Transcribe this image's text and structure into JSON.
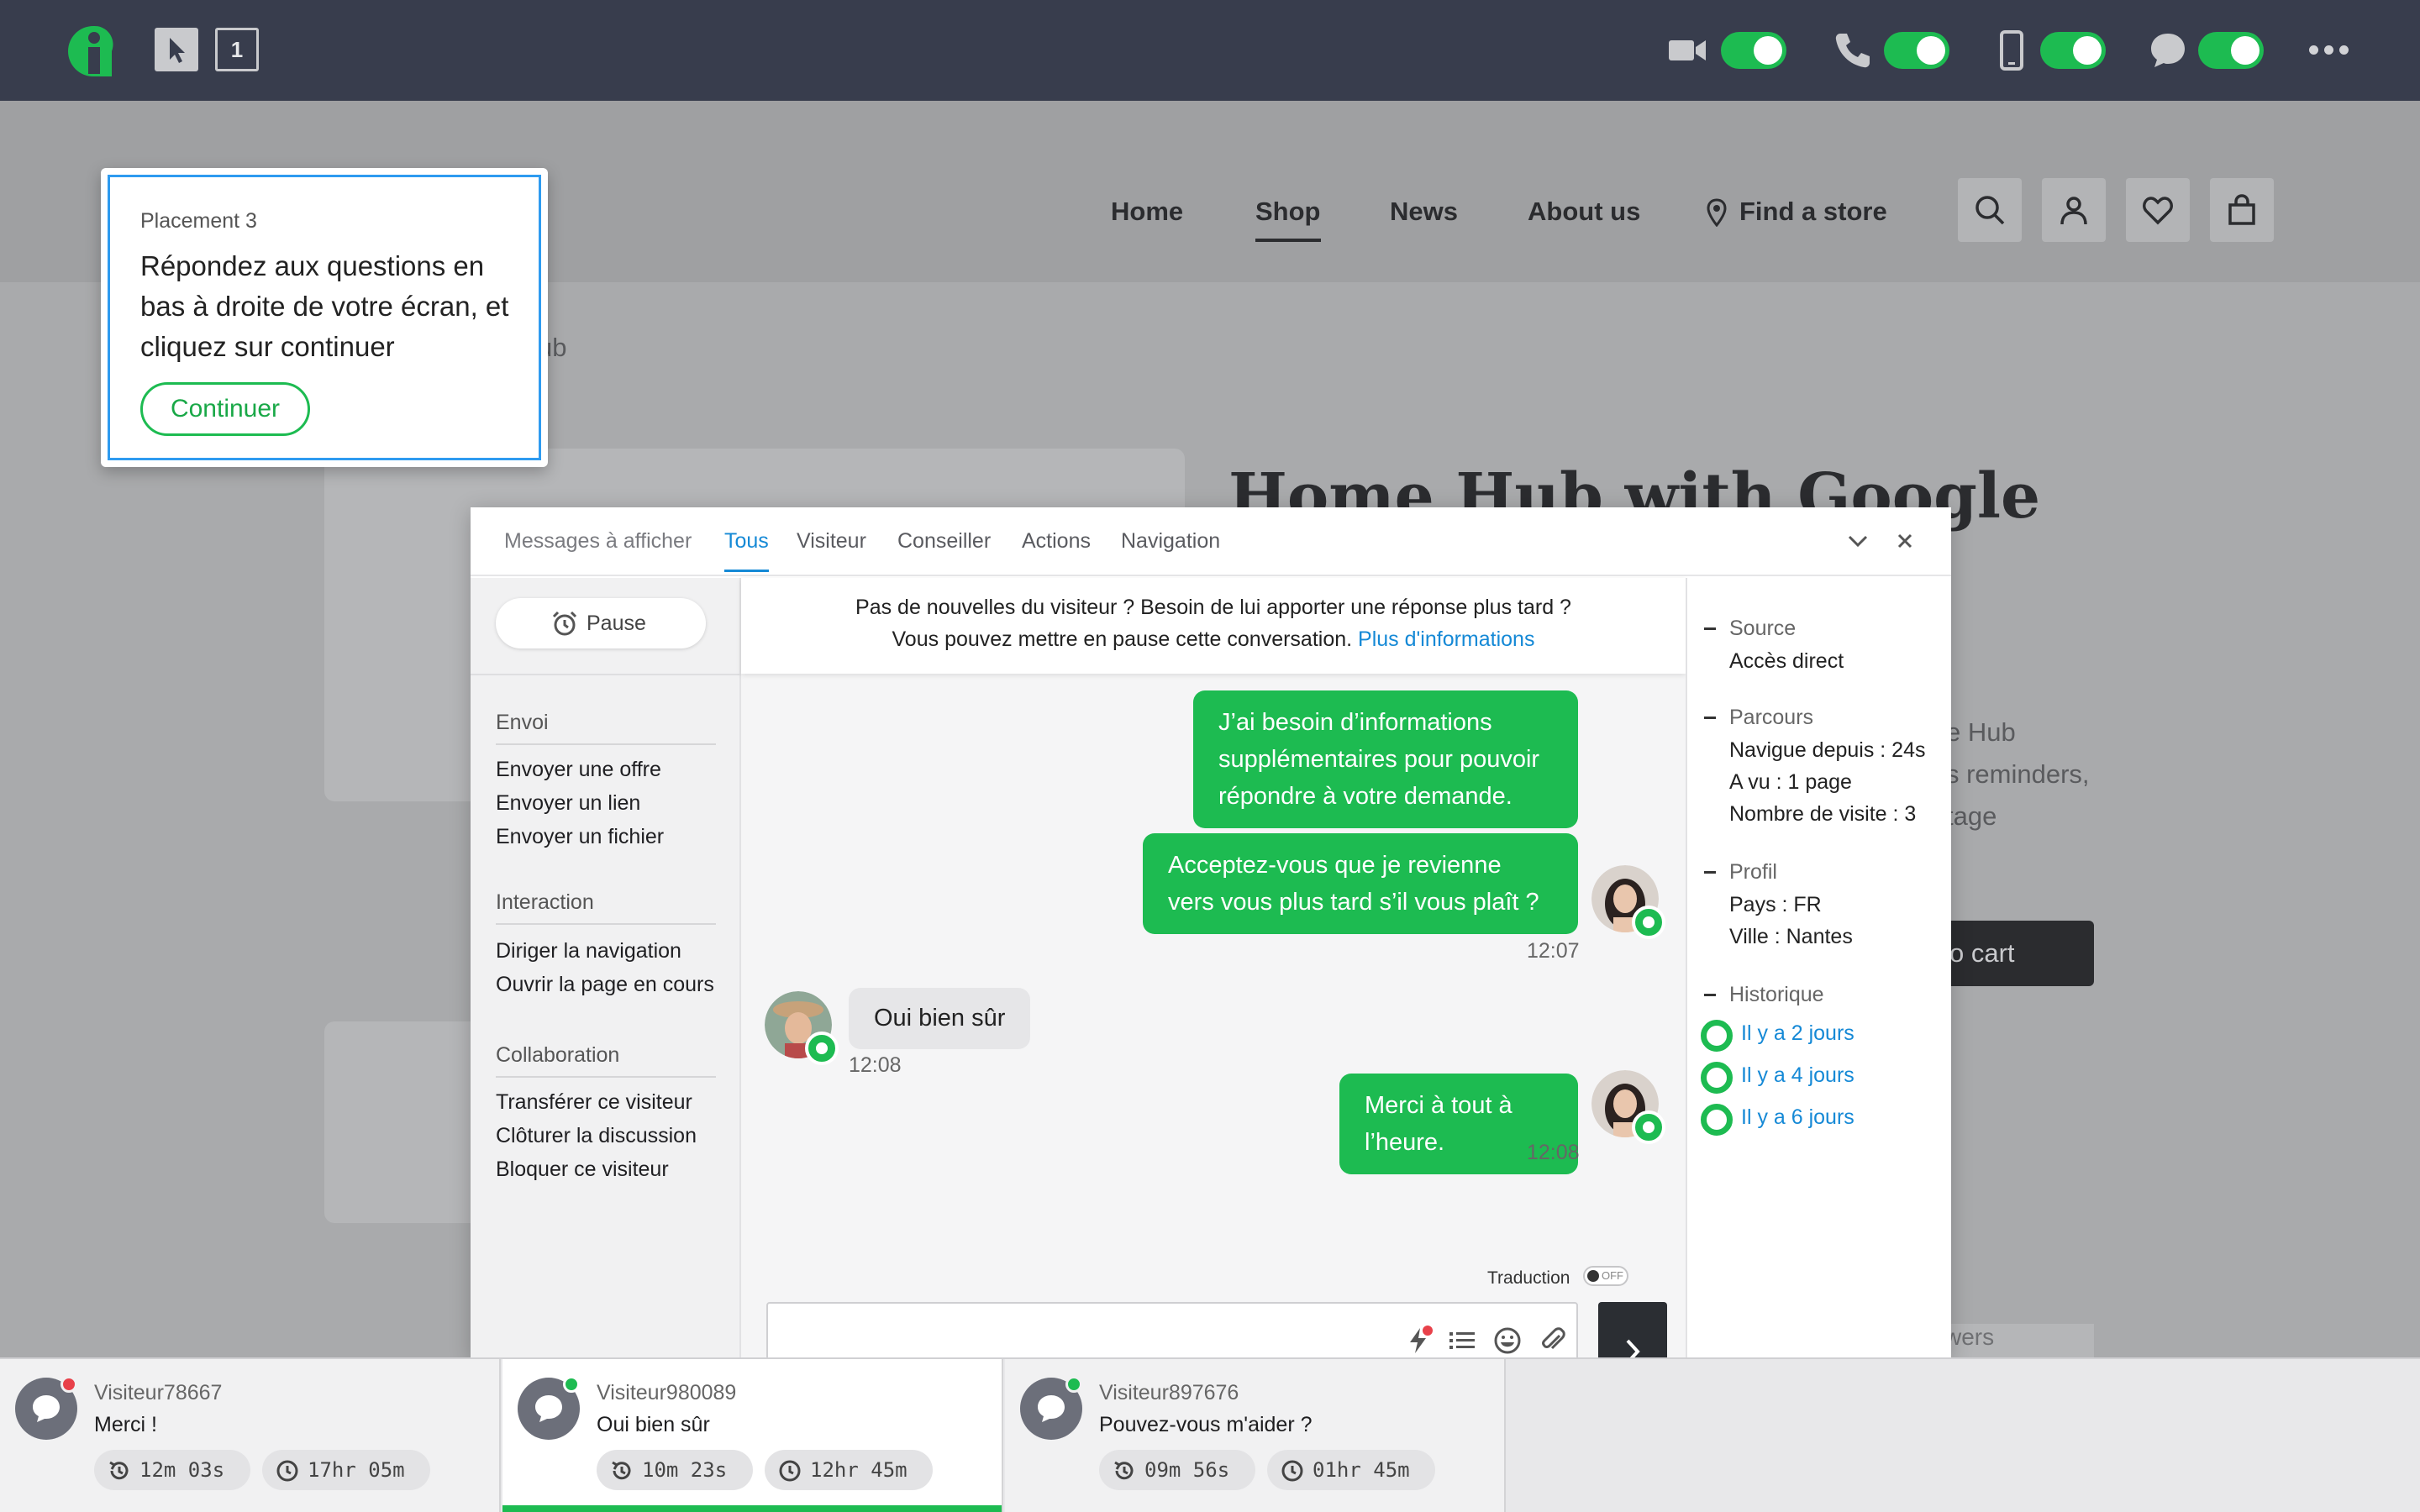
{
  "topbar": {
    "cursor_label": "1",
    "icons": [
      "logo-icon",
      "cursor-icon",
      "video-icon",
      "phone-icon",
      "mobile-icon",
      "chat-bubble-icon",
      "more-icon"
    ],
    "toggles": {
      "video": true,
      "phone": true,
      "mobile": true,
      "chat": true
    },
    "accent_color": "#1dbb51",
    "bar_color": "#383d4d"
  },
  "site": {
    "nav": [
      "Home",
      "Shop",
      "News",
      "About us",
      "Find a store"
    ],
    "active_nav": "Shop",
    "breadcrumb_tail": "ub",
    "product_title": "Home Hub with Google",
    "desc_lines": [
      "e Hub",
      "s reminders,",
      "tage"
    ],
    "cart_label": "o cart",
    "answers_label": "swers"
  },
  "tooltip": {
    "eyebrow": "Placement 3",
    "body": "Répondez aux questions en bas à droite de votre écran, et cliquez sur continuer",
    "button": "Continuer"
  },
  "panel": {
    "filter_label": "Messages à afficher",
    "tabs": [
      "Tous",
      "Visiteur",
      "Conseiller",
      "Actions",
      "Navigation"
    ],
    "active_tab": "Tous",
    "pause_label": "Pause",
    "sections": [
      {
        "title": "Envoi",
        "actions": [
          "Envoyer une offre",
          "Envoyer un lien",
          "Envoyer un fichier"
        ]
      },
      {
        "title": "Interaction",
        "actions": [
          "Diriger la navigation",
          "Ouvrir la page en cours"
        ]
      },
      {
        "title": "Collaboration",
        "actions": [
          "Transférer ce visiteur",
          "Clôturer la discussion",
          "Bloquer ce visiteur"
        ]
      }
    ],
    "notice": {
      "line1": "Pas de nouvelles du visiteur ? Besoin de lui apporter une réponse plus tard ?",
      "line2": "Vous pouvez mettre en pause cette conversation.",
      "link": "Plus d'informations"
    },
    "messages": [
      {
        "from": "agent",
        "text": "J’ai besoin d’informations supplémentaires pour pouvoir répondre à votre demande."
      },
      {
        "from": "agent",
        "text": "Acceptez-vous que je revienne vers vous plus tard s’il vous plaît ?",
        "time": "12:07"
      },
      {
        "from": "visitor",
        "text": "Oui bien sûr",
        "time": "12:08"
      },
      {
        "from": "agent",
        "text": "Merci à tout à l’heure.",
        "time": "12:08"
      }
    ],
    "translation_label": "Traduction",
    "translation_state": "OFF",
    "info": {
      "source_label": "Source",
      "source_value": "Accès direct",
      "parcours_label": "Parcours",
      "parcours_values": [
        "Navigue depuis : 24s",
        "A vu : 1 page",
        "Nombre de visite : 3"
      ],
      "profil_label": "Profil",
      "profil_values": [
        "Pays : FR",
        "Ville : Nantes"
      ],
      "historique_label": "Historique",
      "historique_items": [
        "Il y a 2 jours",
        "Il y a 4 jours",
        "Il y a 6 jours"
      ]
    }
  },
  "visitors": [
    {
      "name": "Visiteur78667",
      "message": "Merci !",
      "elapsed": "12m 03s",
      "duration": "17hr 05m",
      "status_color": "#e8414a",
      "active": false
    },
    {
      "name": "Visiteur980089",
      "message": "Oui bien sûr",
      "elapsed": "10m 23s",
      "duration": "12hr 45m",
      "status_color": "#1dbb51",
      "active": true
    },
    {
      "name": "Visiteur897676",
      "message": "Pouvez-vous m'aider ?",
      "elapsed": "09m 56s",
      "duration": "01hr 45m",
      "status_color": "#1dbb51",
      "active": false
    }
  ]
}
